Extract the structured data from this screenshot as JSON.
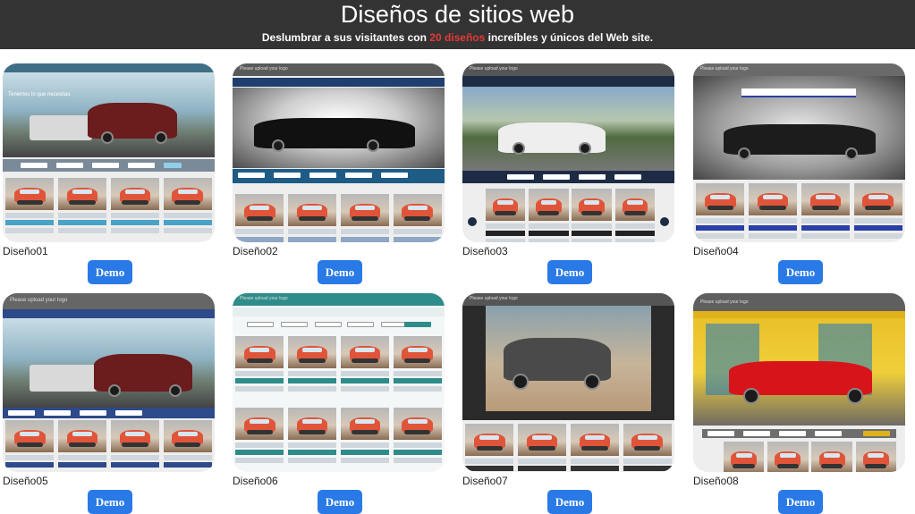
{
  "header": {
    "title": "Diseños de sitios web",
    "subtitle_before": "Deslumbrar a sus visitantes con ",
    "subtitle_highlight": "20 diseños",
    "subtitle_after": " increíbles y únicos del Web site."
  },
  "colors": {
    "header_bg": "#333333",
    "highlight": "#e53935",
    "demo_button": "#2979e6"
  },
  "designs": [
    {
      "caption": "Diseño01",
      "button": "Demo"
    },
    {
      "caption": "Diseño02",
      "button": "Demo"
    },
    {
      "caption": "Diseño03",
      "button": "Demo"
    },
    {
      "caption": "Diseño04",
      "button": "Demo"
    },
    {
      "caption": "Diseño05",
      "button": "Demo"
    },
    {
      "caption": "Diseño06",
      "button": "Demo"
    },
    {
      "caption": "Diseño07",
      "button": "Demo"
    },
    {
      "caption": "Diseño08",
      "button": "Demo"
    }
  ],
  "thumb_text": {
    "logo": "Please upload your logo",
    "hero_slogan": "Tenemos lo que necesitas"
  }
}
